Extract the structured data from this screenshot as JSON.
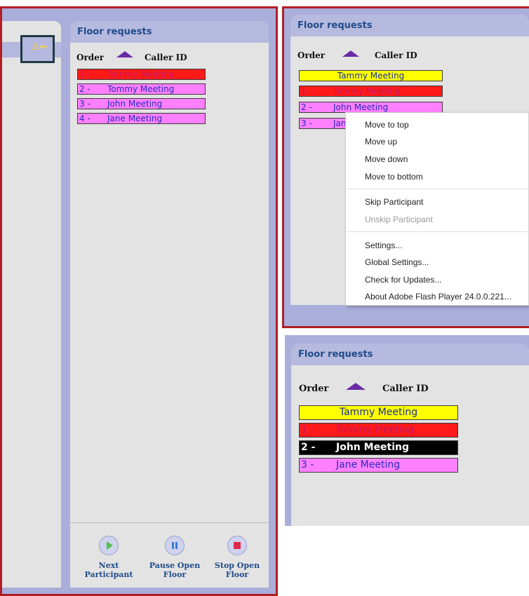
{
  "panel_title": "Floor requests",
  "columns": {
    "order": "Order",
    "caller_id": "Caller ID"
  },
  "left_panel": {
    "rows": [
      {
        "num": "1 -",
        "name": "Tammy Meeting"
      },
      {
        "num": "2 -",
        "name": "Tommy Meeting"
      },
      {
        "num": "3 -",
        "name": "John Meeting"
      },
      {
        "num": "4 -",
        "name": "Jane Meeting"
      }
    ],
    "toolbar": {
      "next_line1": "Next",
      "next_line2": "Participant",
      "pause_line1": "Pause Open",
      "pause_line2": "Floor",
      "stop_line1": "Stop Open",
      "stop_line2": "Floor"
    }
  },
  "top_right_panel": {
    "current": "Tammy Meeting",
    "rows": [
      {
        "num": "1 -",
        "name": "Tommy Meeting"
      },
      {
        "num": "2 -",
        "name": "John Meeting"
      },
      {
        "num": "3 -",
        "name": "Jane Meeting"
      }
    ]
  },
  "context_menu": {
    "move_to_top": "Move to top",
    "move_up": "Move up",
    "move_down": "Move down",
    "move_to_bottom": "Move to bottom",
    "skip": "Skip Participant",
    "unskip": "Unskip Participant",
    "settings": "Settings...",
    "global_settings": "Global Settings...",
    "check_updates": "Check for Updates...",
    "about": "About Adobe Flash Player 24.0.0.221..."
  },
  "bottom_right_panel": {
    "current": "Tammy Meeting",
    "rows": [
      {
        "num": "1 -",
        "name": "Tommy Meeting"
      },
      {
        "num": "2 -",
        "name": "John Meeting"
      },
      {
        "num": "3 -",
        "name": "Jane Meeting"
      }
    ]
  },
  "colors": {
    "frame_red": "#b11f24",
    "panel_blue": "#a9aedb",
    "header_blue": "#b7badf",
    "row_red": "#ff1a1a",
    "row_pink": "#ff80ff",
    "row_yellow": "#ffff00",
    "row_selected": "#000000",
    "sort_arrow": "#6a2ca6"
  },
  "icons": {
    "sort_arrow": "triangle-up",
    "collapse": "participants-arrow-left-icon",
    "next": "play-icon",
    "pause": "pause-icon",
    "stop": "stop-icon"
  }
}
